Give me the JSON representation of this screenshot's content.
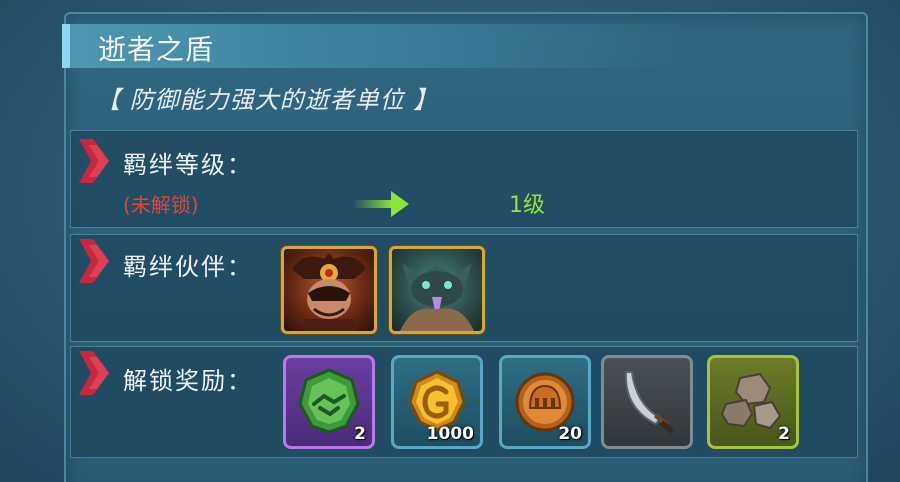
{
  "header": {
    "title": "逝者之盾",
    "subtitle": "【 防御能力强大的逝者单位 】"
  },
  "bond_level": {
    "label": "羁绊等级：",
    "current": "(未解锁)",
    "next": "1级"
  },
  "bond_partners": {
    "label": "羁绊伙伴：",
    "partners": [
      {
        "icon": "horned-warrior-portrait"
      },
      {
        "icon": "shadow-beast-portrait"
      }
    ]
  },
  "rewards": {
    "label": "解锁奖励：",
    "items": [
      {
        "icon": "handshake-token-icon",
        "count": "2"
      },
      {
        "icon": "gold-coin-icon",
        "count": "1000"
      },
      {
        "icon": "helmet-coin-icon",
        "count": "20"
      },
      {
        "icon": "scimitar-icon",
        "count": ""
      },
      {
        "icon": "ore-rock-icon",
        "count": "2"
      }
    ]
  },
  "colors": {
    "locked_red": "#e0463c",
    "level_green": "#8de63a",
    "accent_red": "#c8283c"
  }
}
